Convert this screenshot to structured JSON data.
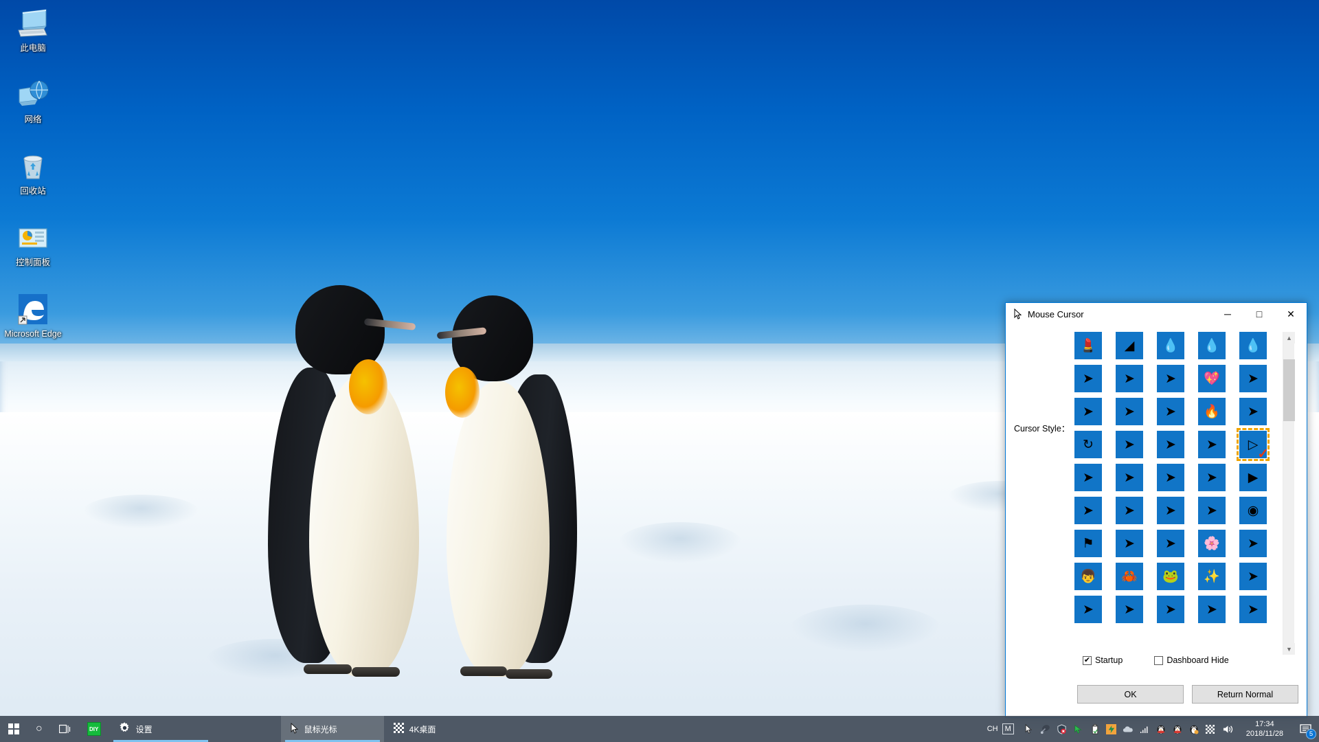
{
  "desktop": {
    "icons": [
      {
        "label": "此电脑",
        "icon": "this-pc-icon"
      },
      {
        "label": "网络",
        "icon": "network-icon"
      },
      {
        "label": "回收站",
        "icon": "recycle-bin-icon"
      },
      {
        "label": "控制面板",
        "icon": "control-panel-icon"
      },
      {
        "label": "Microsoft Edge",
        "icon": "microsoft-edge-icon"
      }
    ]
  },
  "dialog": {
    "title": "Mouse Cursor",
    "title_icon": "cursor-arrow-icon",
    "minimize_label": "─",
    "maximize_label": "□",
    "close_label": "✕",
    "cursor_style_label": "Cursor Style：",
    "selected_index": 19,
    "tiles": [
      "💄",
      "◢",
      "💧",
      "💧",
      "💧",
      "➤",
      "➤",
      "➤",
      "💖",
      "➤",
      "➤",
      "➤",
      "➤",
      "🔥",
      "➤",
      "↻",
      "➤",
      "➤",
      "➤",
      "▷",
      "➤",
      "➤",
      "➤",
      "➤",
      "▶",
      "➤",
      "➤",
      "➤",
      "➤",
      "◉",
      "⚑",
      "➤",
      "➤",
      "🌸",
      "➤",
      "👦",
      "🦀",
      "🐸",
      "✨",
      "➤",
      "➤",
      "➤",
      "➤",
      "➤",
      "➤"
    ],
    "tile_color": "#1175c7",
    "selection_color": "#efa400",
    "check_color": "#e03a18",
    "startup": {
      "label": "Startup",
      "checked": true,
      "mark": "✔"
    },
    "dashboard_hide": {
      "label": "Dashboard Hide",
      "checked": false,
      "mark": ""
    },
    "ok_label": "OK",
    "return_normal_label": "Return Normal",
    "scrollbar": {
      "up_arrow": "▲",
      "down_arrow": "▼"
    }
  },
  "taskbar": {
    "start_label": "start-button",
    "search_label": "○",
    "taskview_label": "⧉",
    "diy_label": "DIY",
    "settings_label": "设置",
    "mouse_cursor_label": "鼠标光标",
    "desktop4k_label": "4K桌面",
    "tray_icons": [
      "cursor-arrow-icon",
      "satellite-dish-icon",
      "shield-error-icon",
      "green-cursor-icon",
      "usb-drive-icon",
      "thunder-download-icon",
      "onedrive-cloud-icon",
      "wifi-icon",
      "qq-penguin-icon",
      "qq-penguin-icon",
      "qq-penguin-icon",
      "checker-icon",
      "volume-icon"
    ],
    "ime_lang": "CH",
    "ime_mode": "M",
    "time": "17:34",
    "date": "2018/11/28",
    "notification_count": "5"
  }
}
